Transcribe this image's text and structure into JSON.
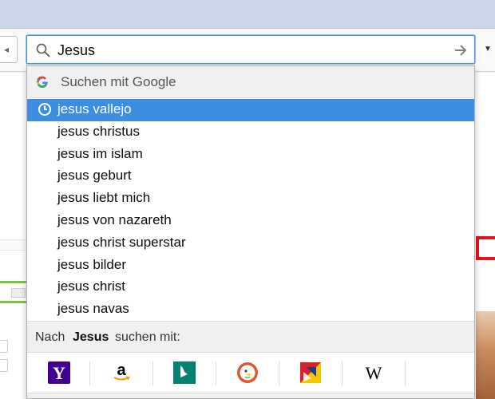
{
  "search": {
    "query": "Jesus"
  },
  "dropdown": {
    "header_label": "Suchen mit Google",
    "suggestions": [
      "jesus vallejo",
      "jesus christus",
      "jesus im islam",
      "jesus geburt",
      "jesus liebt mich",
      "jesus von nazareth",
      "jesus christ superstar",
      "jesus bilder",
      "jesus christ",
      "jesus navas"
    ],
    "selected_index": 0,
    "nach_prefix": "Nach",
    "nach_query": "Jesus",
    "nach_suffix": "suchen mit:",
    "engines": [
      {
        "name": "yahoo",
        "glyph": "Y",
        "color": "#400090"
      },
      {
        "name": "amazon",
        "glyph": "a",
        "color": "#000000"
      },
      {
        "name": "bing",
        "glyph": "b",
        "color": "#008373"
      },
      {
        "name": "duckduckgo",
        "glyph": "",
        "color": "#de5833"
      },
      {
        "name": "leo",
        "glyph": "",
        "color": "#f7c400"
      },
      {
        "name": "wikipedia",
        "glyph": "W",
        "color": "#000000"
      }
    ]
  },
  "colors": {
    "selected": "#3d8ee0",
    "focus_border": "#4a90d9"
  }
}
